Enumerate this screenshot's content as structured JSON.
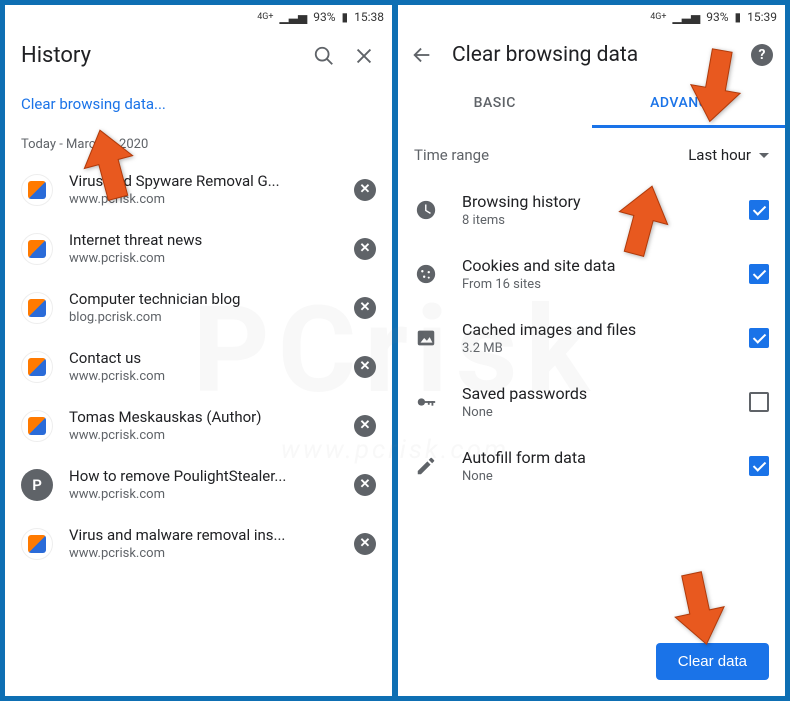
{
  "left": {
    "status": {
      "net": "4G+",
      "signal": "▁▃▅",
      "battery_pct": "93%",
      "time": "15:38"
    },
    "title": "History",
    "clear_link": "Clear browsing data...",
    "date_header": "Today - March 9, 2020",
    "items": [
      {
        "title": "Virus and Spyware Removal G...",
        "url": "www.pcrisk.com",
        "icon": "pcrisk"
      },
      {
        "title": "Internet threat news",
        "url": "www.pcrisk.com",
        "icon": "pcrisk"
      },
      {
        "title": "Computer technician blog",
        "url": "blog.pcrisk.com",
        "icon": "pcrisk"
      },
      {
        "title": "Contact us",
        "url": "www.pcrisk.com",
        "icon": "pcrisk"
      },
      {
        "title": "Tomas Meskauskas (Author)",
        "url": "www.pcrisk.com",
        "icon": "pcrisk"
      },
      {
        "title": "How to remove PoulightStealer...",
        "url": "www.pcrisk.com",
        "icon": "p"
      },
      {
        "title": "Virus and malware removal ins...",
        "url": "www.pcrisk.com",
        "icon": "pcrisk"
      }
    ]
  },
  "right": {
    "status": {
      "net": "4G+",
      "signal": "▁▃▅",
      "battery_pct": "93%",
      "time": "15:39"
    },
    "title": "Clear browsing data",
    "tabs": {
      "basic": "BASIC",
      "advanced": "ADVANCED",
      "active": "advanced"
    },
    "time_range": {
      "label": "Time range",
      "value": "Last hour"
    },
    "options": [
      {
        "icon": "clock",
        "title": "Browsing history",
        "sub": "8 items",
        "checked": true
      },
      {
        "icon": "cookie",
        "title": "Cookies and site data",
        "sub": "From 16 sites",
        "checked": true
      },
      {
        "icon": "image",
        "title": "Cached images and files",
        "sub": "3.2 MB",
        "checked": true
      },
      {
        "icon": "key",
        "title": "Saved passwords",
        "sub": "None",
        "checked": false
      },
      {
        "icon": "pencil",
        "title": "Autofill form data",
        "sub": "None",
        "checked": true
      }
    ],
    "clear_button": "Clear data"
  },
  "watermark": {
    "main": "PCrisk",
    "sub": "www.pcrisk.com"
  }
}
